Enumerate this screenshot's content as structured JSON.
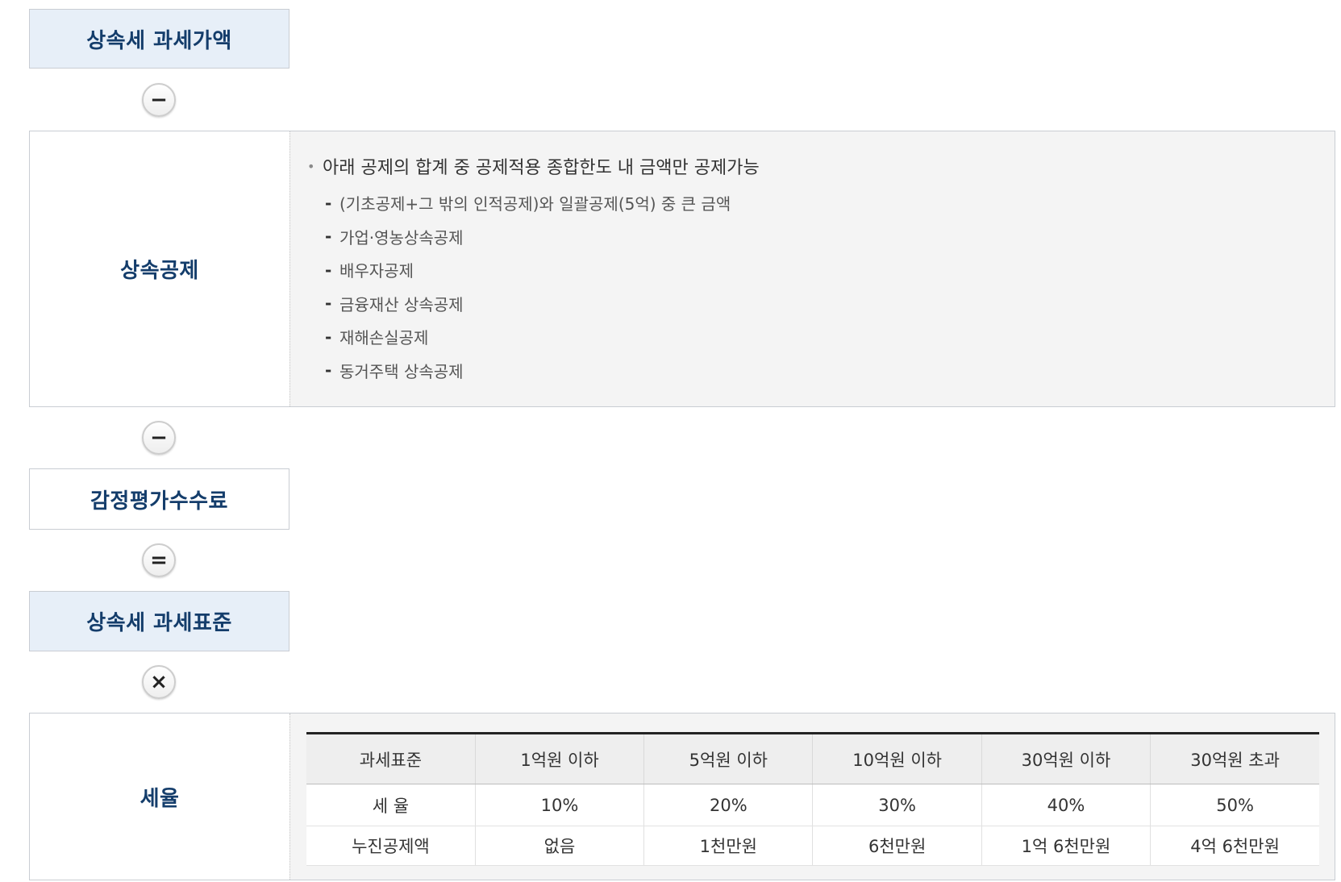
{
  "colors": {
    "heading_text": "#143d6b",
    "highlight_bg": "#e7eff8",
    "panel_bg": "#f4f4f4"
  },
  "flow": {
    "taxable_value": {
      "label": "상속세 과세가액"
    },
    "operator_1": {
      "symbol": "−",
      "icon": "minus-icon"
    },
    "deduction": {
      "label": "상속공제",
      "note": "아래 공제의 합계 중 공제적용 종합한도 내 금액만 공제가능",
      "items": [
        "(기초공제+그 밖의 인적공제)와 일괄공제(5억) 중 큰 금액",
        "가업·영농상속공제",
        "배우자공제",
        "금융재산 상속공제",
        "재해손실공제",
        "동거주택 상속공제"
      ]
    },
    "operator_2": {
      "symbol": "−",
      "icon": "minus-icon"
    },
    "appraisal_fee": {
      "label": "감정평가수수료"
    },
    "operator_3": {
      "symbol": "=",
      "icon": "equals-icon"
    },
    "tax_base": {
      "label": "상속세 과세표준"
    },
    "operator_4": {
      "symbol": "×",
      "icon": "times-icon"
    },
    "tax_rate": {
      "label": "세율",
      "table": {
        "headers": [
          "과세표준",
          "1억원 이하",
          "5억원 이하",
          "10억원 이하",
          "30억원 이하",
          "30억원 초과"
        ],
        "rows": [
          [
            "세 율",
            "10%",
            "20%",
            "30%",
            "40%",
            "50%"
          ],
          [
            "누진공제액",
            "없음",
            "1천만원",
            "6천만원",
            "1억 6천만원",
            "4억 6천만원"
          ]
        ]
      }
    }
  }
}
